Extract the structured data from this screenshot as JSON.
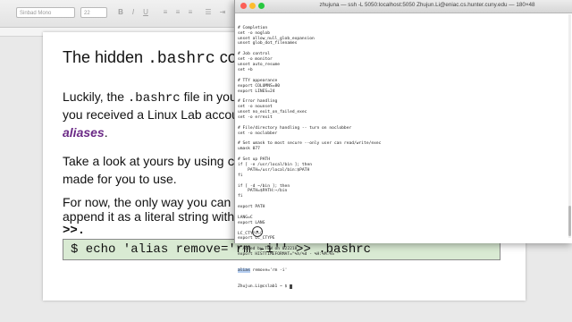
{
  "toolbar": {
    "font_name": "Sinbad Mono",
    "font_size": "22",
    "icons": [
      "bold-icon",
      "italic-icon",
      "underline-icon",
      "align-left-icon",
      "align-center-icon",
      "align-right-icon",
      "list-icon"
    ]
  },
  "slide": {
    "title_prefix": "The hidden ",
    "title_code": ".bashrc",
    "title_suffix": " co",
    "p1_line1_a": "Luckily, the ",
    "p1_line1_code": ".bashrc",
    "p1_line1_b": " file in your h",
    "p1_line2": "you received a Linux Lab account. T",
    "p1_line3_em": "aliases",
    "p1_line3_end": ".",
    "p2_line1_a": "Take a look at yours by using ",
    "p2_line1_code": "cat",
    "p2_line2": "made for you to use.",
    "p3_line1": "For now, the only way you can edi",
    "p3_line2": "append it as a literal string with ec",
    "p3_line3": ">>.",
    "command": "$ echo 'alias remove='rm -i'' >> .bashrc"
  },
  "terminal": {
    "title": "zhujuna — ssh -L 5050:localhost:5050 Zhujun.Li@eniac.cs.hunter.cuny.edu — 180×48",
    "lines": [
      "# Completion",
      "set -o noglob",
      "unset allow_null_glob_expansion",
      "unset glob_dot_filenames",
      "",
      "# Job control",
      "set -o monitor",
      "unset auto_resume",
      "set +b",
      "",
      "# TTY appearance",
      "export COLUMNS=80",
      "export LINES=24",
      "",
      "# Error handling",
      "set -o nounset",
      "unset no_exit_on_failed_exec",
      "set -o errexit",
      "",
      "# File/directory handling -- turn on noclobber",
      "set -o noclobber",
      "",
      "# Set umask to most secure --only user can read/write/exec",
      "umask 077",
      "",
      "# Set up PATH",
      "if [ -e /usr/local/bin ]; then",
      "    PATH=/usr/local/bin:$PATH",
      "fi",
      "",
      "if [ -d ~/bin ]; then",
      "    PATH=$PATH:~/bin",
      "fi",
      "",
      "export PATH",
      "",
      "LANG=C",
      "export LANG",
      "",
      "LC_CTYPE=C",
      "export LC_CTYPE",
      "",
      "# Added by TBW on 022218",
      "export HISTTIMEFORMAT=\"%h/%d - %H:%M:%S \""
    ],
    "alias_prefix": "alias",
    "alias_rest": " remove='rm -i'",
    "prompt": "Zhujun.Li@cslab1 ~ $ "
  }
}
